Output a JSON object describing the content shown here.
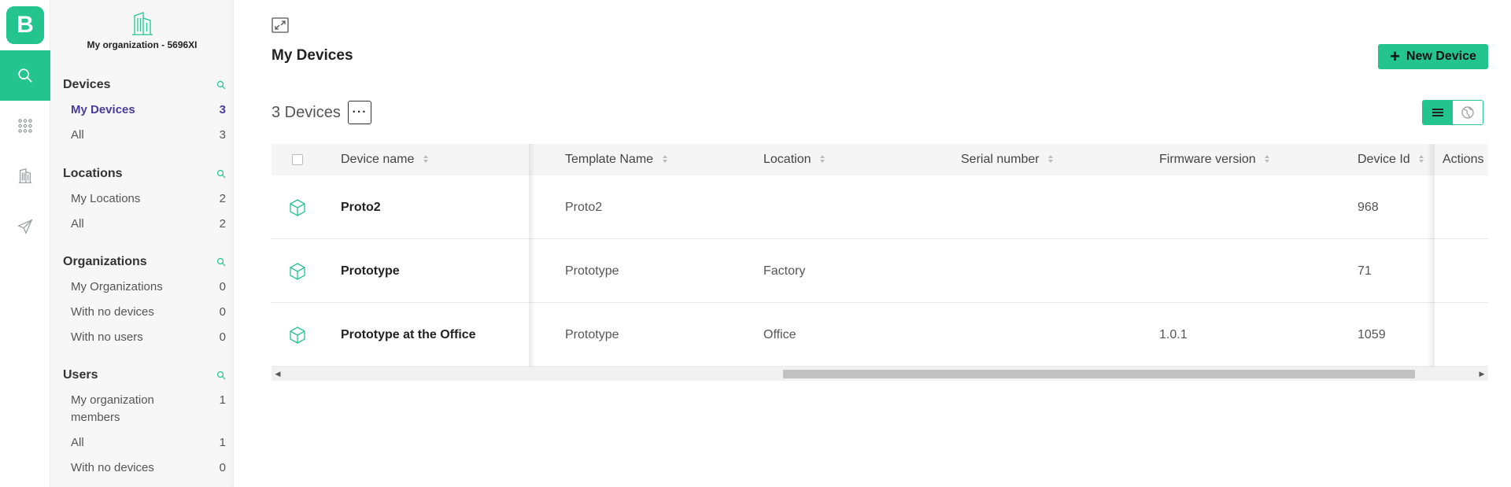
{
  "app": {
    "logo_letter": "B"
  },
  "rail": {
    "items": [
      {
        "icon": "search-icon",
        "active": true
      },
      {
        "icon": "apps-grid-icon",
        "active": false
      },
      {
        "icon": "building-icon",
        "active": false
      },
      {
        "icon": "send-icon",
        "active": false
      }
    ]
  },
  "sidebar": {
    "org_name": "My organization - 5696XI",
    "sections": [
      {
        "title": "Devices",
        "items": [
          {
            "label": "My Devices",
            "count": "3"
          },
          {
            "label": "All",
            "count": "3"
          }
        ]
      },
      {
        "title": "Locations",
        "items": [
          {
            "label": "My Locations",
            "count": "2"
          },
          {
            "label": "All",
            "count": "2"
          }
        ]
      },
      {
        "title": "Organizations",
        "items": [
          {
            "label": "My Organizations",
            "count": "0"
          },
          {
            "label": "With no devices",
            "count": "0"
          },
          {
            "label": "With no users",
            "count": "0"
          }
        ]
      },
      {
        "title": "Users",
        "items": [
          {
            "label": "My organization members",
            "count": "1"
          },
          {
            "label": "All",
            "count": "1"
          },
          {
            "label": "With no devices",
            "count": "0"
          }
        ]
      }
    ]
  },
  "main": {
    "title": "My Devices",
    "new_button": "New Device",
    "count_label": "3 Devices",
    "more_label": "···"
  },
  "table": {
    "columns": [
      "Device name",
      "Template Name",
      "Location",
      "Serial number",
      "Firmware version",
      "Device Id",
      "Actions"
    ],
    "rows": [
      {
        "name": "Proto2",
        "template": "Proto2",
        "location": "",
        "serial": "",
        "firmware": "",
        "id": "968"
      },
      {
        "name": "Prototype",
        "template": "Prototype",
        "location": "Factory",
        "serial": "",
        "firmware": "",
        "id": "71"
      },
      {
        "name": "Prototype at the Office",
        "template": "Prototype",
        "location": "Office",
        "serial": "",
        "firmware": "1.0.1",
        "id": "1059"
      }
    ]
  },
  "colors": {
    "accent": "#23c48e",
    "active_nav": "#4a3c9c"
  }
}
